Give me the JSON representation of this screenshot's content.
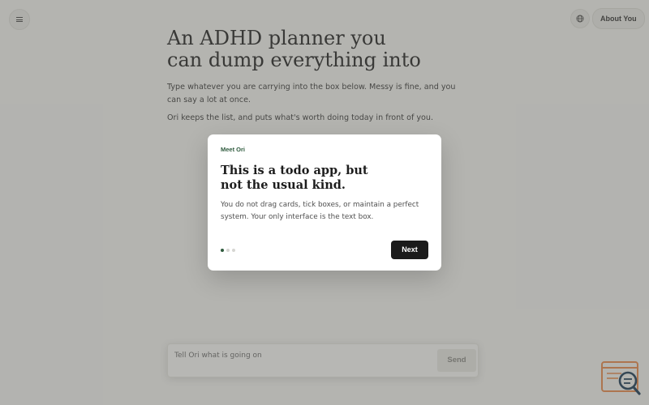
{
  "header": {
    "menu_icon": "hamburger-menu-icon",
    "language_icon": "globe-icon",
    "about_label": "About You"
  },
  "hero": {
    "title_line1": "An ADHD planner you",
    "title_line2": "can dump everything into",
    "paragraph1_line1": "Type whatever you are carrying into the box below. Messy is fine, and you",
    "paragraph1_line2": "can say a lot at once.",
    "paragraph2": "Ori keeps the list, and puts what's worth doing today in front of you."
  },
  "composer": {
    "placeholder": "Tell Ori what is going on",
    "value": "",
    "send_label": "Send"
  },
  "modal": {
    "eyebrow": "Meet Ori",
    "title_line1": "This is a todo app, but",
    "title_line2": "not the usual kind.",
    "body_line1": "You do not drag cards, tick boxes, or maintain a perfect",
    "body_line2": "system. Your only interface is the text box.",
    "step_current": 1,
    "step_total": 3,
    "next_label": "Next"
  },
  "colors": {
    "accent_green": "#2f5b3e",
    "button_dark": "#1b1b1b",
    "page_background": "#f4f4f1",
    "corner_logo": "#e8884a"
  },
  "corner_widget_icon": "search-window-icon"
}
